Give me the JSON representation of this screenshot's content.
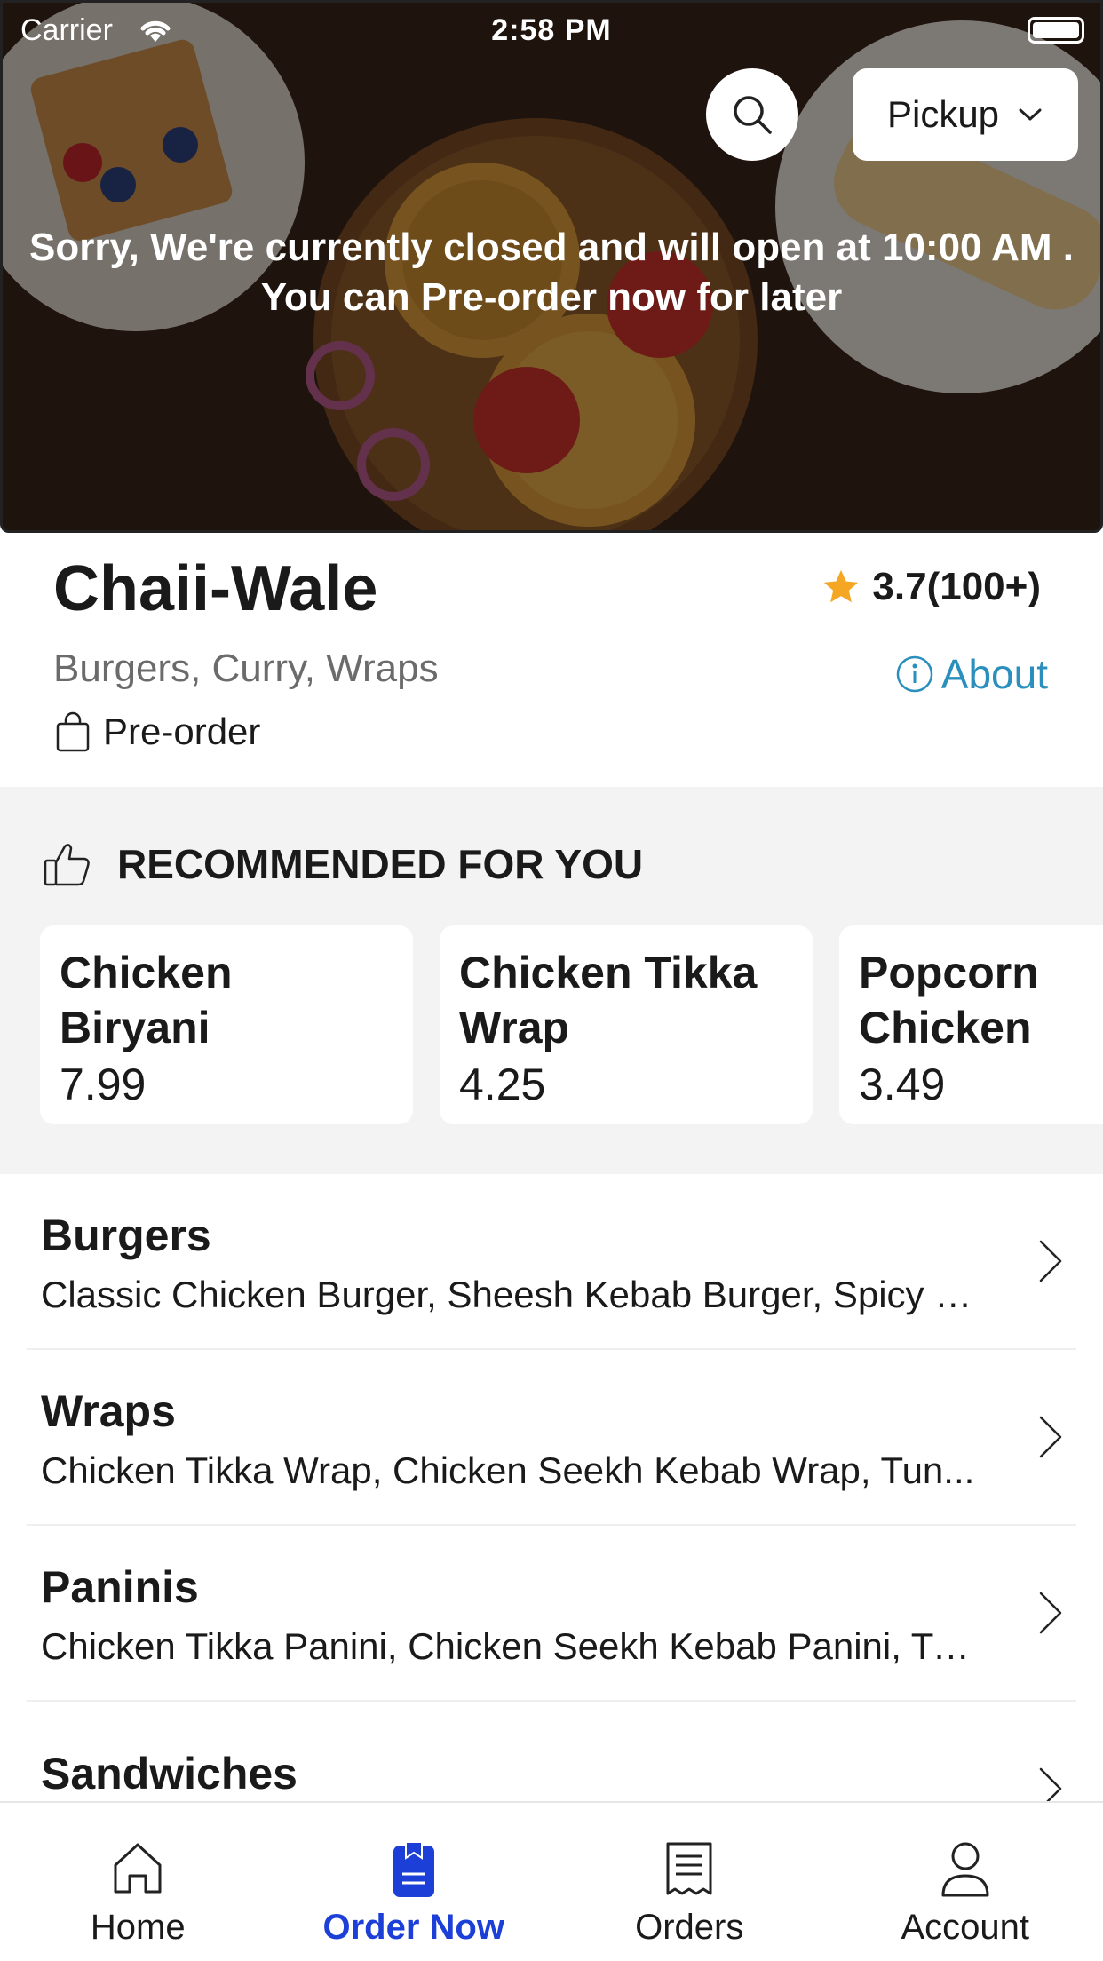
{
  "status": {
    "carrier": "Carrier",
    "time": "2:58 PM"
  },
  "header": {
    "pickup_label": "Pickup",
    "closed_message_line1": "Sorry, We're currently closed and will open at 10:00 AM .",
    "closed_message_line2": "You can Pre-order now for later"
  },
  "restaurant": {
    "name": "Chaii-Wale",
    "rating": "3.7(100+)",
    "cuisines": "Burgers, Curry, Wraps",
    "about_label": "About",
    "preorder_label": "Pre-order"
  },
  "recommended": {
    "title": "RECOMMENDED FOR YOU",
    "items": [
      {
        "name": "Chicken Biryani",
        "price": "7.99"
      },
      {
        "name": "Chicken Tikka Wrap",
        "price": "4.25"
      },
      {
        "name": "Popcorn Chicken",
        "price": "3.49"
      }
    ]
  },
  "categories": [
    {
      "title": "Burgers",
      "items": "Classic Chicken Burger, Sheesh Kebab Burger, Spicy C..."
    },
    {
      "title": "Wraps",
      "items": "Chicken Tikka Wrap, Chicken Seekh Kebab Wrap, Tun..."
    },
    {
      "title": "Paninis",
      "items": "Chicken Tikka Panini, Chicken Seekh Kebab Panini, Tu..."
    },
    {
      "title": "Sandwiches",
      "items": ""
    }
  ],
  "tabs": [
    {
      "label": "Home",
      "icon": "home-icon"
    },
    {
      "label": "Order Now",
      "icon": "order-now-icon"
    },
    {
      "label": "Orders",
      "icon": "receipt-icon"
    },
    {
      "label": "Account",
      "icon": "account-icon"
    }
  ],
  "colors": {
    "accent": "#1c3fd8",
    "about_link": "#2a8fbd",
    "star": "#f5a623",
    "section_bg": "#f3f3f3"
  }
}
